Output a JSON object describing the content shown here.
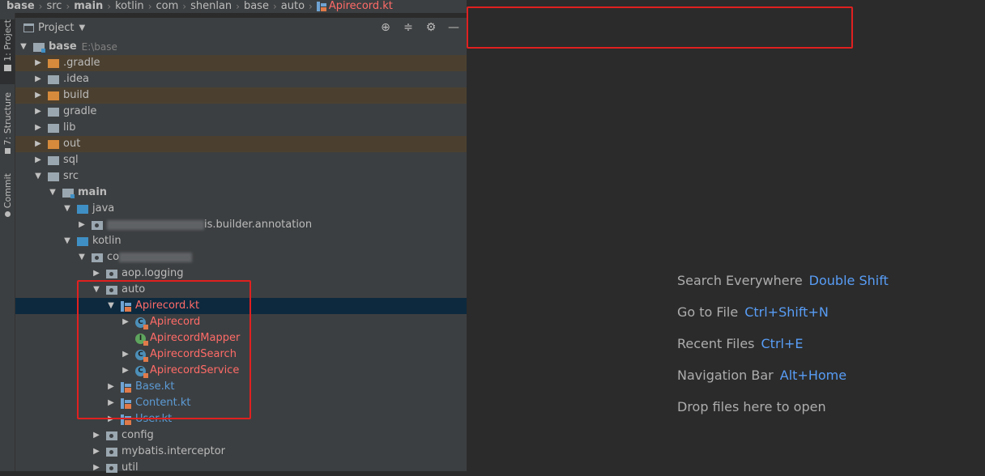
{
  "breadcrumb": {
    "items": [
      "base",
      "src",
      "main",
      "kotlin",
      "com",
      "shenlan",
      "base",
      "auto"
    ],
    "file": "Apirecord.kt"
  },
  "toolstrip": {
    "tabs": [
      "1: Project",
      "7: Structure",
      "Commit"
    ]
  },
  "project_panel": {
    "title": "Project",
    "tools": [
      "crosshair-icon",
      "collapse-icon",
      "gear-icon",
      "minimize-icon"
    ]
  },
  "tree": [
    {
      "depth": 0,
      "arrow": "down",
      "icon": "module",
      "label": "base",
      "style": "bold",
      "extra": "E:\\base"
    },
    {
      "depth": 1,
      "arrow": "right",
      "icon": "orange",
      "label": ".gradle",
      "bg": "excluded"
    },
    {
      "depth": 1,
      "arrow": "right",
      "icon": "gray",
      "label": ".idea"
    },
    {
      "depth": 1,
      "arrow": "right",
      "icon": "orange",
      "label": "build",
      "bg": "excluded"
    },
    {
      "depth": 1,
      "arrow": "right",
      "icon": "gray",
      "label": "gradle"
    },
    {
      "depth": 1,
      "arrow": "right",
      "icon": "gray",
      "label": "lib"
    },
    {
      "depth": 1,
      "arrow": "right",
      "icon": "orange",
      "label": "out",
      "bg": "excluded"
    },
    {
      "depth": 1,
      "arrow": "right",
      "icon": "gray",
      "label": "sql"
    },
    {
      "depth": 1,
      "arrow": "down",
      "icon": "gray",
      "label": "src"
    },
    {
      "depth": 2,
      "arrow": "down",
      "icon": "module",
      "label": "main",
      "style": "bold"
    },
    {
      "depth": 3,
      "arrow": "down",
      "icon": "blue",
      "label": "java"
    },
    {
      "depth": 4,
      "arrow": "right",
      "icon": "pkg",
      "label": "is.builder.annotation",
      "blur": 120
    },
    {
      "depth": 3,
      "arrow": "down",
      "icon": "blue",
      "label": "kotlin"
    },
    {
      "depth": 4,
      "arrow": "down",
      "icon": "pkg",
      "label": "co",
      "blur": 90
    },
    {
      "depth": 5,
      "arrow": "right",
      "icon": "pkg",
      "label": "aop.logging"
    },
    {
      "depth": 5,
      "arrow": "down",
      "icon": "pkg",
      "label": "auto"
    },
    {
      "depth": 6,
      "arrow": "down",
      "icon": "ktfile",
      "label": "Apirecord.kt",
      "style": "red",
      "bg": "selected"
    },
    {
      "depth": 7,
      "arrow": "right",
      "icon": "class",
      "label": "Apirecord",
      "style": "red"
    },
    {
      "depth": 7,
      "arrow": "none",
      "icon": "interface",
      "label": "ApirecordMapper",
      "style": "red"
    },
    {
      "depth": 7,
      "arrow": "right",
      "icon": "class",
      "label": "ApirecordSearch",
      "style": "red"
    },
    {
      "depth": 7,
      "arrow": "right",
      "icon": "class",
      "label": "ApirecordService",
      "style": "red"
    },
    {
      "depth": 6,
      "arrow": "right",
      "icon": "ktfile",
      "label": "Base.kt",
      "style": "blue"
    },
    {
      "depth": 6,
      "arrow": "right",
      "icon": "ktfile",
      "label": "Content.kt",
      "style": "blue"
    },
    {
      "depth": 6,
      "arrow": "right",
      "icon": "ktfile",
      "label": "User.kt",
      "style": "blue"
    },
    {
      "depth": 5,
      "arrow": "right",
      "icon": "pkg",
      "label": "config"
    },
    {
      "depth": 5,
      "arrow": "right",
      "icon": "pkg",
      "label": "mybatis.interceptor"
    },
    {
      "depth": 5,
      "arrow": "right",
      "icon": "pkg",
      "label": "util"
    }
  ],
  "editor_hints": [
    {
      "label": "Search Everywhere",
      "key": "Double Shift"
    },
    {
      "label": "Go to File",
      "key": "Ctrl+Shift+N"
    },
    {
      "label": "Recent Files",
      "key": "Ctrl+E"
    },
    {
      "label": "Navigation Bar",
      "key": "Alt+Home"
    },
    {
      "label": "Drop files here to open",
      "key": ""
    }
  ],
  "colors": {
    "accent_key": "#589df6",
    "error_red": "#ff6b68",
    "annotation_red": "#e02020",
    "selection": "#0d293e"
  }
}
